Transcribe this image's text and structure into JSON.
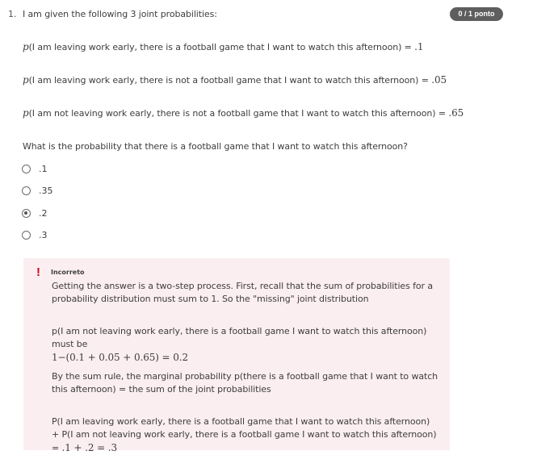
{
  "question": {
    "number": "1.",
    "title": "I am given the following 3 joint probabilities:",
    "score_badge": "0 / 1 ponto",
    "statements": [
      {
        "p": "p",
        "text": "(I am leaving work early, there is a football game that I want to watch this afternoon) = ",
        "value": ".1"
      },
      {
        "p": "p",
        "text": "(I am leaving work early, there is not a football game that I want to watch this afternoon) = ",
        "value": ".05"
      },
      {
        "p": "p",
        "text": "(I am not leaving work early, there is not a football game that I want to watch this afternoon) = ",
        "value": ".65"
      }
    ],
    "prompt": "What is the probability that there is a football game that I want to watch this afternoon?",
    "options": [
      {
        "label": ".1",
        "selected": false
      },
      {
        "label": ".35",
        "selected": false
      },
      {
        "label": ".2",
        "selected": true
      },
      {
        "label": ".3",
        "selected": false
      }
    ]
  },
  "feedback": {
    "icon": "exclamation-icon",
    "status": "Incorreto",
    "colors": {
      "background": "#fbeef0",
      "icon": "#d0021b"
    },
    "p1": "Getting the answer is a two-step process. First, recall that the sum of probabilities for a probability distribution must sum to 1. So the \"missing\" joint distribution",
    "p2": "p(I am not leaving work early, there is a football game I want to watch this afternoon) must be",
    "p2_math": "1−(0.1 + 0.05 + 0.65) = 0.2",
    "p3": "By the sum rule, the marginal probability p(there is a football game that I want to watch this afternoon) = the sum of the joint probabilities",
    "p4": "P(I am leaving work early, there is a football game that I want to watch this afternoon) + P(I am not leaving work early, there is a football game I want to watch this afternoon) = ",
    "p4_math": ".1 + .2 = .3"
  }
}
